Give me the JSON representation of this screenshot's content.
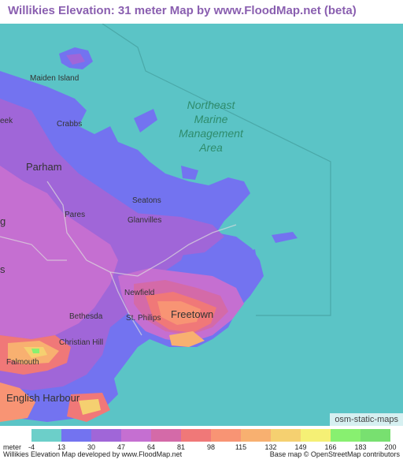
{
  "title": "Willikies Elevation: 31 meter Map by www.FloodMap.net (beta)",
  "map": {
    "water_color": "#5bc4c6",
    "marine_area_label": [
      "Northeast",
      "Marine",
      "Management",
      "Area"
    ],
    "places": {
      "maiden_island": "Maiden Island",
      "crabbs": "Crabbs",
      "eek": "eek",
      "parham": "Parham",
      "pares": "Pares",
      "seatons": "Seatons",
      "glanvilles": "Glanvilles",
      "newfield": "Newfield",
      "bethesda": "Bethesda",
      "st_philips": "St. Philips",
      "freetown": "Freetown",
      "christian_hill": "Christian Hill",
      "falmouth": "Falmouth",
      "english_harbour": "English Harbour",
      "g": "g",
      "s": "s"
    },
    "badge": "osm-static-maps"
  },
  "legend": {
    "unit_label": "meter",
    "colors": [
      "#6ccfc9",
      "#7373f0",
      "#a066d8",
      "#c56fd1",
      "#d46aa8",
      "#f07878",
      "#f89474",
      "#f8b070",
      "#f5d070",
      "#f5f075",
      "#88f070",
      "#78e070"
    ],
    "ticks": [
      "-4",
      "13",
      "30",
      "47",
      "64",
      "81",
      "98",
      "115",
      "132",
      "149",
      "166",
      "183",
      "200"
    ]
  },
  "footer": {
    "left": "Willikies Elevation Map developed by www.FloodMap.net",
    "right": "Base map © OpenStreetMap contributors"
  }
}
